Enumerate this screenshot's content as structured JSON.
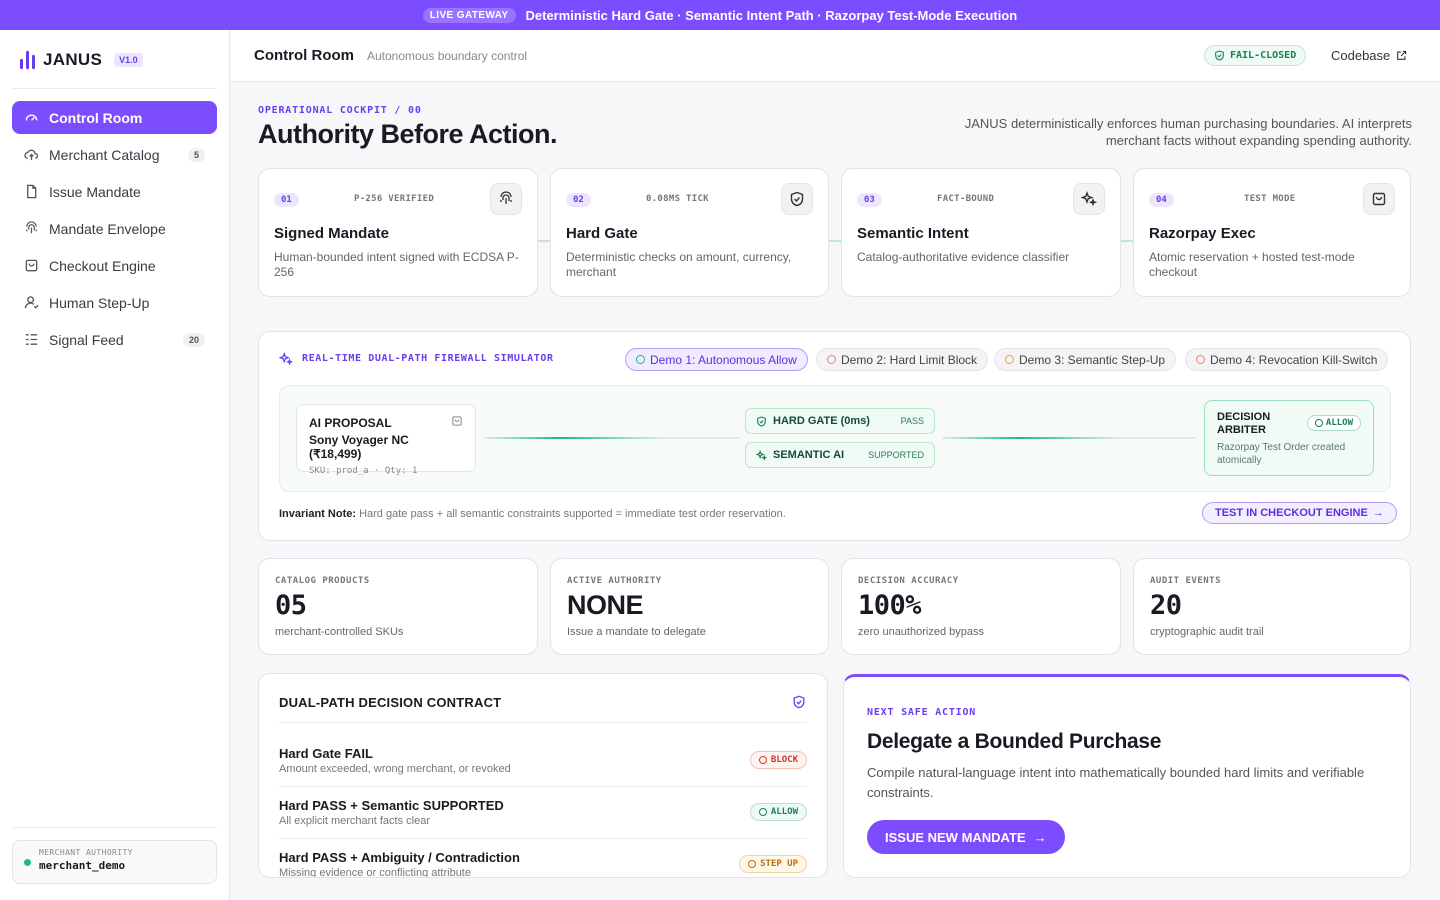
{
  "banner": {
    "pill": "LIVE GATEWAY",
    "text": "Deterministic Hard Gate · Semantic Intent Path · Razorpay Test-Mode Execution"
  },
  "brand": {
    "name": "JANUS",
    "version": "V1.0"
  },
  "nav": [
    {
      "label": "Control Room",
      "icon": "gauge-icon",
      "active": true
    },
    {
      "label": "Merchant Catalog",
      "icon": "cloud-icon",
      "badge": "5"
    },
    {
      "label": "Issue Mandate",
      "icon": "document-icon"
    },
    {
      "label": "Mandate Envelope",
      "icon": "fingerprint-icon"
    },
    {
      "label": "Checkout Engine",
      "icon": "bag-icon"
    },
    {
      "label": "Human Step-Up",
      "icon": "user-icon"
    },
    {
      "label": "Signal Feed",
      "icon": "list-icon",
      "badge": "20"
    }
  ],
  "merchant": {
    "label": "MERCHANT AUTHORITY",
    "value": "merchant_demo"
  },
  "header": {
    "title": "Control Room",
    "subtitle": "Autonomous boundary control",
    "status": "FAIL-CLOSED",
    "codebase": "Codebase"
  },
  "hero": {
    "eyebrow": "OPERATIONAL COCKPIT / 00",
    "title": "Authority Before Action.",
    "description": "JANUS deterministically enforces human purchasing boundaries. AI interprets merchant facts without expanding spending authority."
  },
  "steps": [
    {
      "num": "01",
      "tag": "P-256 VERIFIED",
      "title": "Signed Mandate",
      "desc": "Human-bounded intent signed with ECDSA P-256",
      "icon": "fingerprint-icon"
    },
    {
      "num": "02",
      "tag": "0.08MS TICK",
      "title": "Hard Gate",
      "desc": "Deterministic checks on amount, currency, merchant",
      "icon": "shield-icon"
    },
    {
      "num": "03",
      "tag": "FACT-BOUND",
      "title": "Semantic Intent",
      "desc": "Catalog-authoritative evidence classifier",
      "icon": "sparkle-icon"
    },
    {
      "num": "04",
      "tag": "TEST MODE",
      "title": "Razorpay Exec",
      "desc": "Atomic reservation + hosted test-mode checkout",
      "icon": "bag-icon"
    }
  ],
  "simulator": {
    "title": "REAL-TIME DUAL-PATH FIREWALL SIMULATOR",
    "demos": [
      "Demo 1: Autonomous Allow",
      "Demo 2: Hard Limit Block",
      "Demo 3: Semantic Step-Up",
      "Demo 4: Revocation Kill-Switch"
    ],
    "proposal": {
      "label": "AI PROPOSAL",
      "product": "Sony Voyager NC (₹18,499)",
      "meta": "SKU: prod_a · Qty: 1"
    },
    "hard_gate": {
      "label": "HARD GATE (0ms)",
      "status": "PASS"
    },
    "semantic": {
      "label": "SEMANTIC AI",
      "status": "SUPPORTED"
    },
    "arbiter": {
      "title": "DECISION ARBITER",
      "status": "ALLOW",
      "desc": "Razorpay Test Order created atomically"
    },
    "note_label": "Invariant Note:",
    "note": "Hard gate pass + all semantic constraints supported = immediate test order reservation.",
    "cta": "TEST IN CHECKOUT ENGINE"
  },
  "stats": [
    {
      "label": "CATALOG PRODUCTS",
      "value": "05",
      "sub": "merchant-controlled SKUs"
    },
    {
      "label": "ACTIVE AUTHORITY",
      "value": "NONE",
      "sub": "Issue a mandate to delegate"
    },
    {
      "label": "DECISION ACCURACY",
      "value": "100%",
      "sub": "zero unauthorized bypass"
    },
    {
      "label": "AUDIT EVENTS",
      "value": "20",
      "sub": "cryptographic audit trail"
    }
  ],
  "contract": {
    "title": "DUAL-PATH DECISION CONTRACT",
    "rows": [
      {
        "title": "Hard Gate FAIL",
        "sub": "Amount exceeded, wrong merchant, or revoked",
        "pill": "BLOCK"
      },
      {
        "title": "Hard PASS + Semantic SUPPORTED",
        "sub": "All explicit merchant facts clear",
        "pill": "ALLOW"
      },
      {
        "title": "Hard PASS + Ambiguity / Contradiction",
        "sub": "Missing evidence or conflicting attribute",
        "pill": "STEP UP"
      }
    ]
  },
  "next": {
    "eyebrow": "NEXT SAFE ACTION",
    "title": "Delegate a Bounded Purchase",
    "desc": "Compile natural-language intent into mathematically bounded hard limits and verifiable constraints.",
    "cta": "ISSUE NEW MANDATE"
  },
  "colors": {
    "accent": "#7c4dff",
    "success": "#1bb98a",
    "danger": "#c53a2a",
    "warning": "#b86e0b"
  }
}
